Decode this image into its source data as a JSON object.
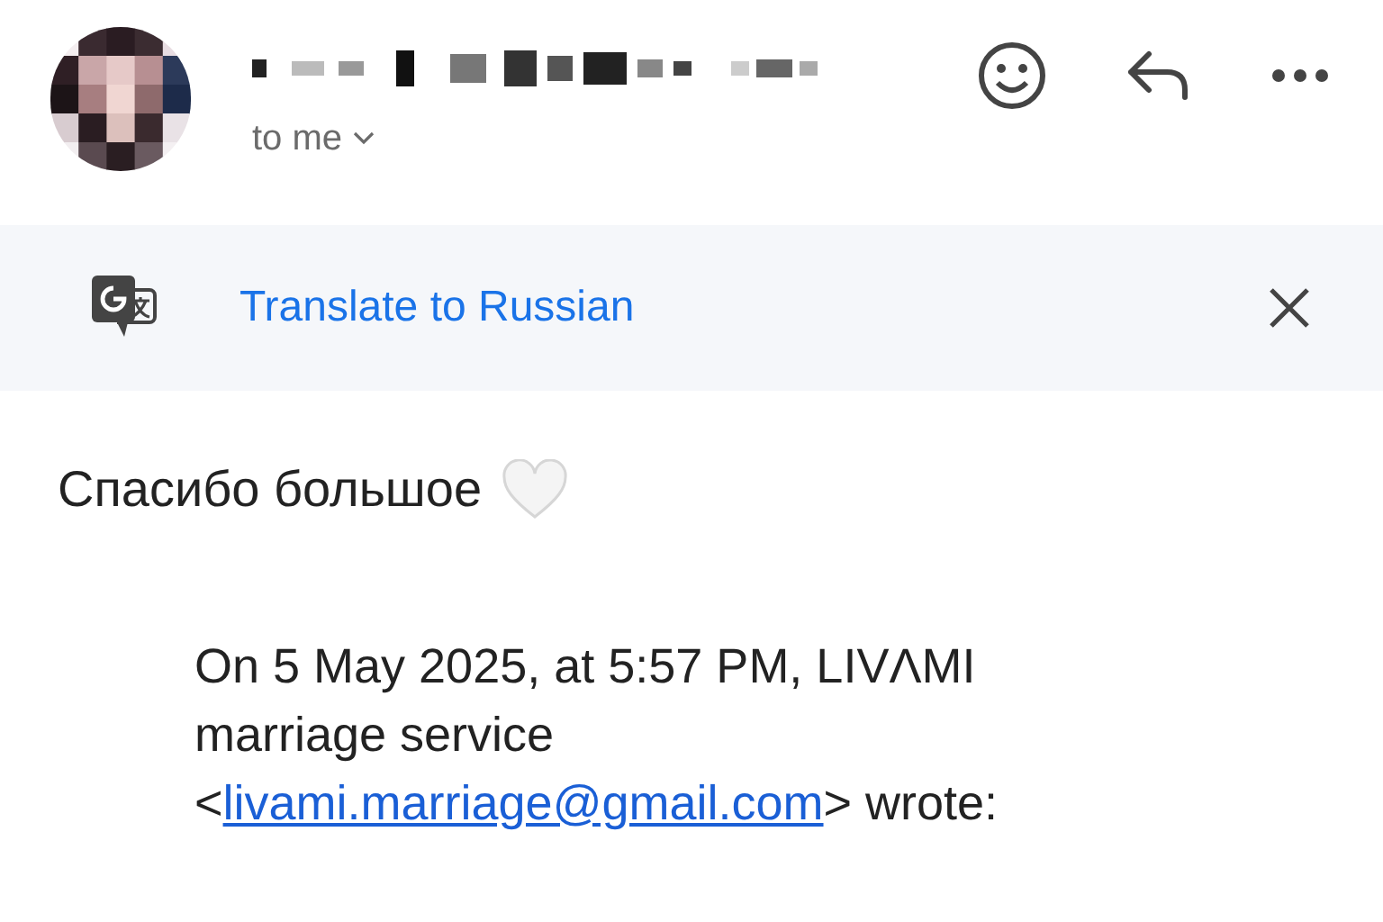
{
  "header": {
    "recipient_label": "to me"
  },
  "translate_bar": {
    "label": "Translate to Russian"
  },
  "message": {
    "body": "Спасибо большое"
  },
  "quote": {
    "prefix": "On 5 May 2025, at 5:57 PM, LIVΛMI marriage service <",
    "email": "livami.marriage@gmail.com",
    "suffix": "> wrote:"
  }
}
